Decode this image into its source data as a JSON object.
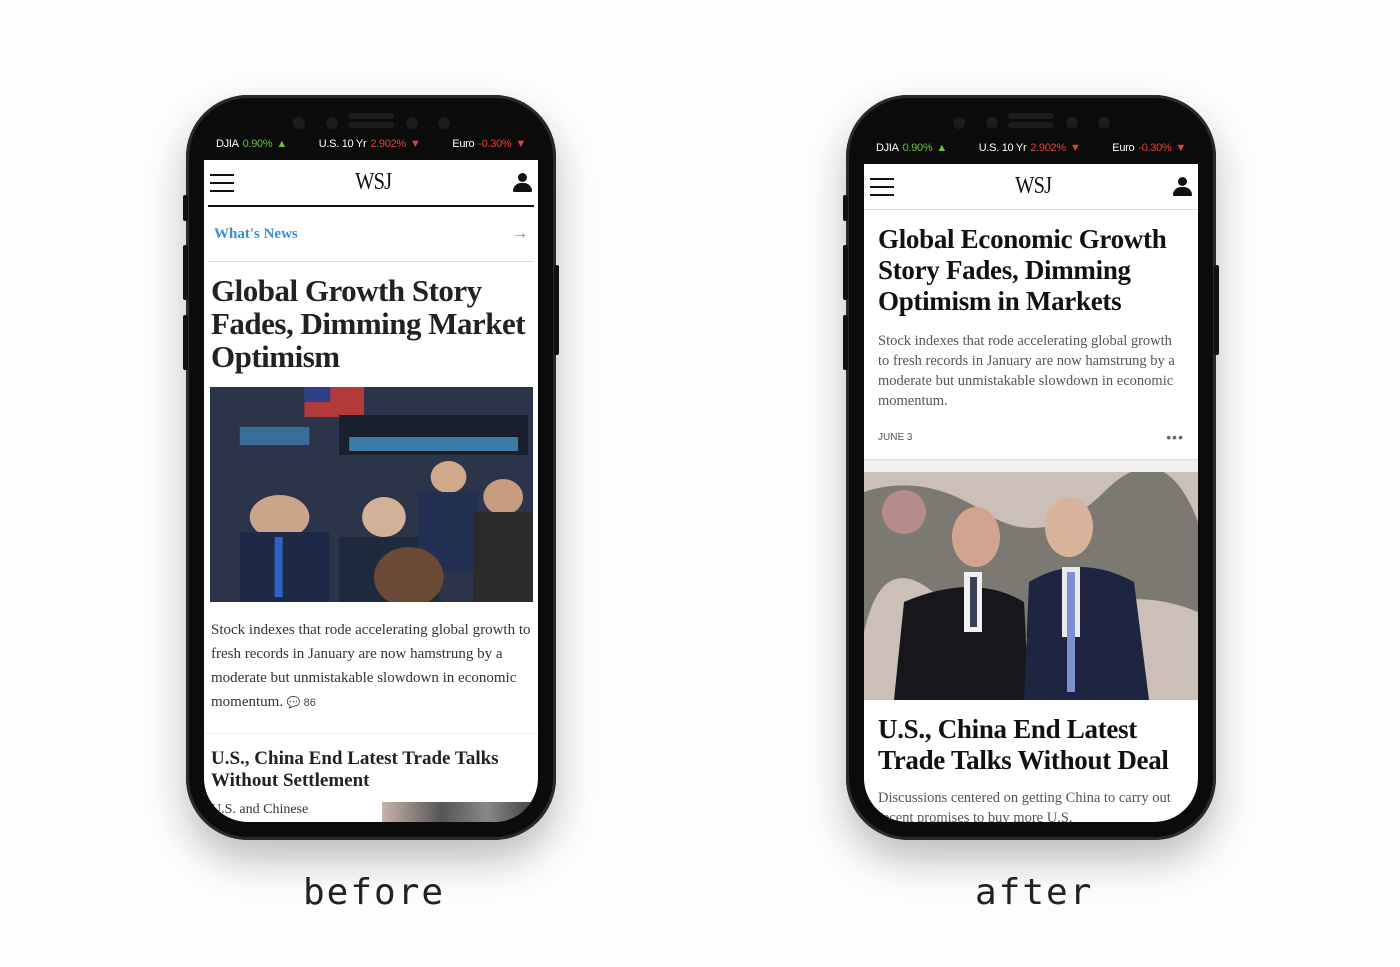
{
  "captions": {
    "before": "before",
    "after": "after"
  },
  "ticker": [
    {
      "name": "DJIA",
      "value": "0.90%",
      "direction": "up",
      "arrow": "▲"
    },
    {
      "name": "U.S. 10 Yr",
      "value": "2.902%",
      "direction": "down",
      "arrow": "▼"
    },
    {
      "name": "Euro",
      "value": "-0.30%",
      "direction": "down",
      "arrow": "▼"
    }
  ],
  "colors": {
    "up": "#6abf3f",
    "down": "#e04040",
    "link": "#3a8fd0"
  },
  "before": {
    "logo": "WSJ",
    "section_label": "What's News",
    "section_arrow": "→",
    "headline": "Global Growth Story Fades, Dimming Market Optimism",
    "image_alt": "Traders on the NYSE floor",
    "summary": "Stock indexes that rode accelerating global growth to fresh records in January are now hamstrung by a moderate but unmistakable slowdown in economic momentum.",
    "comment_count": "86",
    "headline2": "U.S., China End Latest Trade Talks Without Settlement",
    "teaser2": "U.S. and Chinese"
  },
  "after": {
    "logo": "WSJ",
    "headline": "Global Economic Growth Story Fades, Dimming Optimism in Markets",
    "summary": "Stock indexes that rode accelerating global growth to fresh records in January are now hamstrung by a moderate but unmistakable slowdown in economic momentum.",
    "date": "JUNE 3",
    "more": "•••",
    "image_alt": "U.S. and Chinese officials in front of a painting",
    "headline2": "U.S., China End Latest Trade Talks Without Deal",
    "summary2": "Discussions centered on getting China to carry out recent promises to buy more U.S."
  }
}
